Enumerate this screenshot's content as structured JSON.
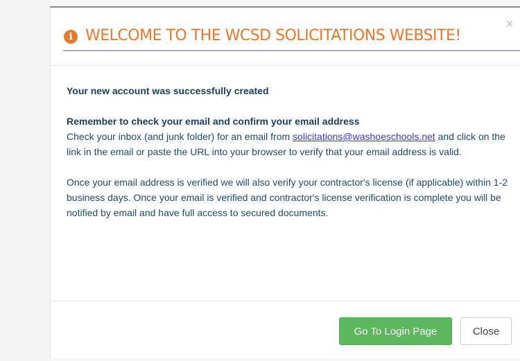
{
  "modal": {
    "title": "WELCOME TO THE WCSD SOLICITATIONS WEBSITE!",
    "info_icon_glyph": "i",
    "close_x": "×",
    "body": {
      "success_heading": "Your new account was successfully created",
      "remember_heading": "Remember to check your email and confirm your email address",
      "check_text_before": "Check your inbox (and junk folder) for an email from ",
      "email_address": "solicitations@washoeschools.net",
      "check_text_after": " and click on the link in the email or paste the URL into your browser to verify that your email address is valid.",
      "verify_text": "Once your email address is verified we will also verify your contractor's license (if applicable) within 1-2 business days. Once your email is verified and contractor's license verification is complete you will be notified by email and have full access to secured documents."
    },
    "footer": {
      "login_label": "Go To Login Page",
      "close_label": "Close"
    }
  },
  "colors": {
    "title_orange": "#e8782b",
    "body_text": "#1d4a6b",
    "link": "#3a39d8",
    "success_green": "#5cb85c"
  },
  "icons": {
    "info": "info-circle-icon",
    "close": "close-icon"
  }
}
